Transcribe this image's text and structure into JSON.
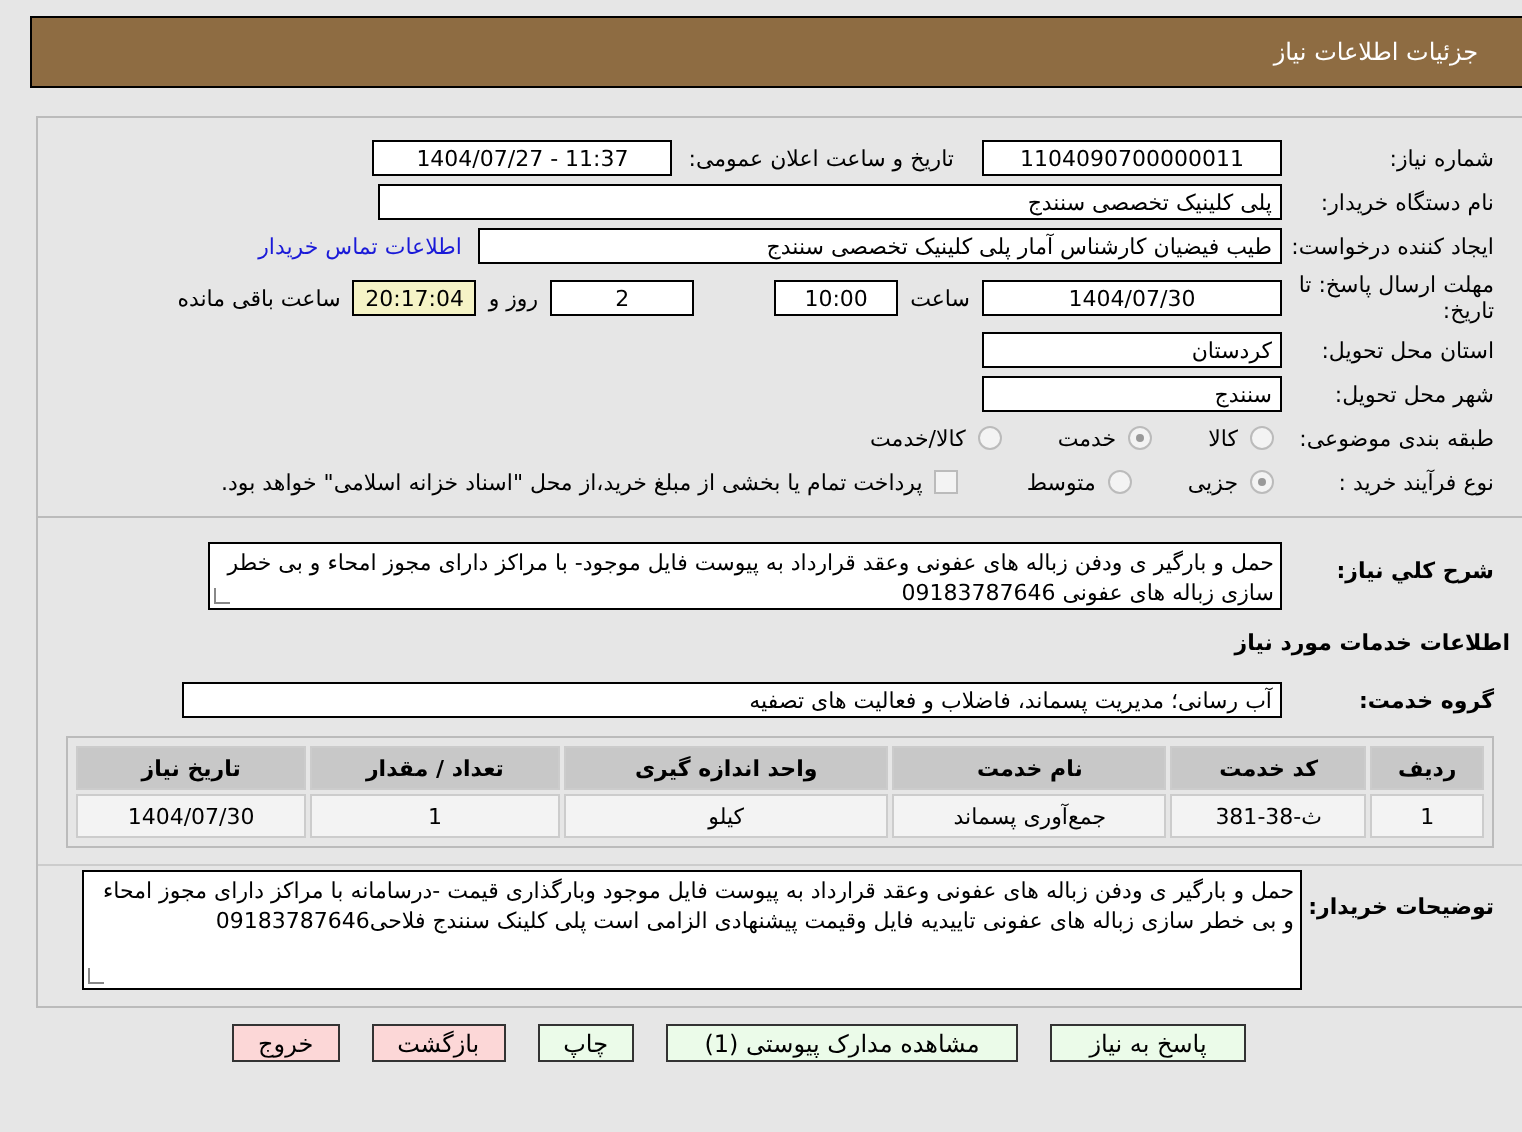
{
  "header": {
    "title": "جزئیات اطلاعات نیاز"
  },
  "need_number": {
    "label": "شماره نیاز:",
    "value": "1104090700000011"
  },
  "announce": {
    "label": "تاریخ و ساعت اعلان عمومی:",
    "value": "1404/07/27 - 11:37"
  },
  "buyer_org": {
    "label": "نام دستگاه خریدار:",
    "value": "پلی کلینیک تخصصی سنندج"
  },
  "creator": {
    "label": "ایجاد کننده درخواست:",
    "value": "طیب فیضیان کارشناس آمار پلی کلینیک تخصصی سنندج",
    "link": "اطلاعات تماس خریدار"
  },
  "deadline": {
    "label": "مهلت ارسال پاسخ: تا تاریخ:",
    "date": "1404/07/30",
    "time_label": "ساعت",
    "time": "10:00",
    "days": "2",
    "days_label": "روز و",
    "remaining": "20:17:04",
    "remaining_label": "ساعت باقی مانده"
  },
  "province": {
    "label": "استان محل تحویل:",
    "value": "کردستان"
  },
  "city": {
    "label": "شهر محل تحویل:",
    "value": "سنندج"
  },
  "category": {
    "label": "طبقه بندی موضوعی:",
    "options": [
      {
        "label": "کالا",
        "selected": false
      },
      {
        "label": "خدمت",
        "selected": true
      },
      {
        "label": "کالا/خدمت",
        "selected": false
      }
    ]
  },
  "purchase_type": {
    "label": "نوع فرآیند خرید :",
    "options": [
      {
        "label": "جزیی",
        "selected": true
      },
      {
        "label": "متوسط",
        "selected": false
      }
    ],
    "treasury": {
      "label": "پرداخت تمام یا بخشی از مبلغ خرید،از محل \"اسناد خزانه اسلامی\" خواهد بود.",
      "checked": false
    }
  },
  "description": {
    "label": "شرح کلي نیاز:",
    "value": "حمل و بارگیر ی  ودفن  زباله های عفونی وعقد قرارداد  به پیوست  فایل  موجود-  با مراکز دارای مجوز امحاء و بی خطر سازی زباله های عفونی 09183787646"
  },
  "services_title": "اطلاعات خدمات مورد نیاز",
  "service_group": {
    "label": "گروه خدمت:",
    "value": "آب رسانی؛ مدیریت پسماند، فاضلاب و فعالیت های تصفیه"
  },
  "table": {
    "columns": [
      "ردیف",
      "کد خدمت",
      "نام خدمت",
      "واحد اندازه گیری",
      "تعداد / مقدار",
      "تاریخ نیاز"
    ],
    "rows": [
      [
        "1",
        "ث-38-381",
        "جمع‌آوری پسماند",
        "کیلو",
        "1",
        "1404/07/30"
      ]
    ]
  },
  "buyer_notes": {
    "label": "توضیحات خریدار:",
    "value": "حمل و بارگیر ی  ودفن  زباله های عفونی وعقد قرارداد  به پیوست  فایل  موجود وبارگذاری قیمت -درسامانه  با مراکز دارای مجوز امحاء و بی خطر سازی زباله های عفونی  تاییدیه فایل وقیمت پیشنهادی الزامی است  پلی کلینک سنندج فلاحی09183787646"
  },
  "buttons": [
    {
      "label": "پاسخ به نیاز",
      "kind": "primary"
    },
    {
      "label": "مشاهده مدارک پیوستی (1)",
      "kind": "primary"
    },
    {
      "label": "چاپ",
      "kind": "primary"
    },
    {
      "label": "بازگشت",
      "kind": "danger"
    },
    {
      "label": "خروج",
      "kind": "danger"
    }
  ]
}
